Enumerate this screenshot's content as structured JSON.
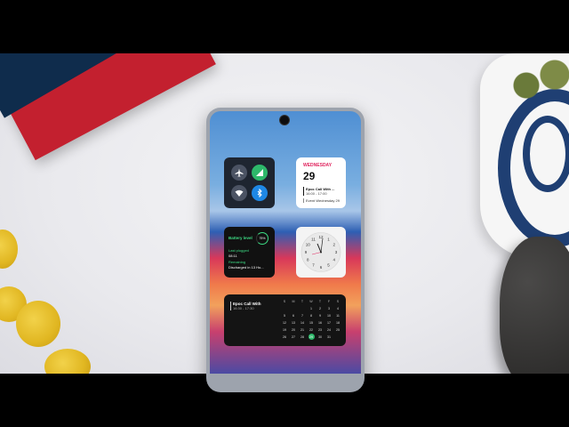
{
  "quick_settings": {
    "airplane_icon": "airplane-icon",
    "signal_icon": "signal-icon",
    "wifi_icon": "wifi-icon",
    "bluetooth_icon": "bluetooth-icon",
    "signal_color": "#2db86a",
    "bluetooth_color": "#1e88e5"
  },
  "calendar_widget": {
    "day": "WEDNESDAY",
    "date": "29",
    "event1_title": "Epoc Call With ...",
    "event1_time": "16:00 - 17:00",
    "event2": "Event Wednesday 29",
    "accent": "#e0245e"
  },
  "battery_widget": {
    "title": "Battery level",
    "percent": "75%",
    "last_plugged_label": "Last plugged",
    "last_plugged_value": "08:11",
    "remaining_label": "Remaining",
    "remaining_value": "Discharged in 13 Ho...",
    "accent": "#3ddc84"
  },
  "clock_widget": {
    "numerals": [
      "12",
      "1",
      "2",
      "3",
      "4",
      "5",
      "6",
      "7",
      "8",
      "9",
      "10",
      "11"
    ]
  },
  "agenda_widget": {
    "event_title": "Epoc Call With",
    "event_time": "16:30 - 17:30",
    "weekdays": [
      "S",
      "M",
      "T",
      "W",
      "T",
      "F",
      "S"
    ],
    "weeks": [
      [
        "",
        "",
        "",
        "1",
        "2",
        "3",
        "4"
      ],
      [
        "5",
        "6",
        "7",
        "8",
        "9",
        "10",
        "11"
      ],
      [
        "12",
        "13",
        "14",
        "15",
        "16",
        "17",
        "18"
      ],
      [
        "19",
        "20",
        "21",
        "22",
        "23",
        "24",
        "25"
      ],
      [
        "26",
        "27",
        "28",
        "29",
        "30",
        "31",
        ""
      ]
    ],
    "today": "29",
    "today_color": "#2db86a"
  }
}
